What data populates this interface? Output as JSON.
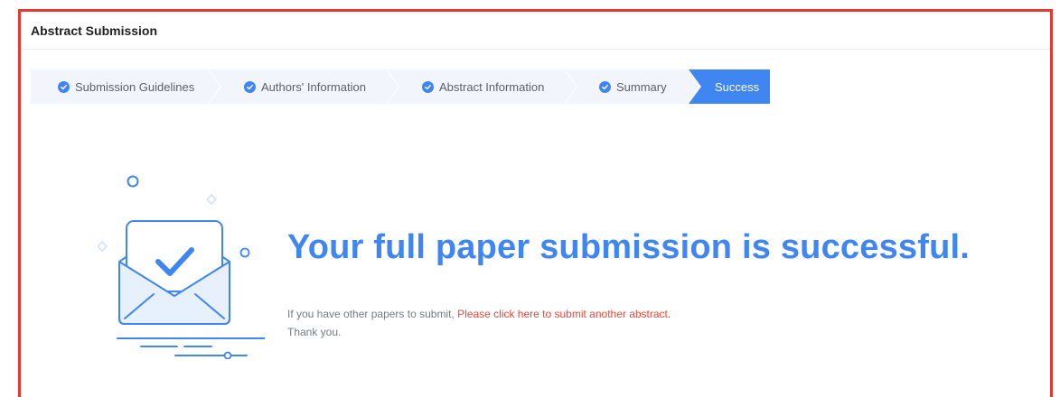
{
  "header": {
    "title": "Abstract Submission"
  },
  "steps": [
    {
      "label": "Submission Guidelines",
      "icon": "check-circle-icon",
      "state": "done"
    },
    {
      "label": "Authors' Information",
      "icon": "check-circle-icon",
      "state": "done"
    },
    {
      "label": "Abstract Information",
      "icon": "check-circle-icon",
      "state": "done"
    },
    {
      "label": "Summary",
      "icon": "check-circle-icon",
      "state": "done"
    },
    {
      "label": "Success",
      "state": "active"
    }
  ],
  "result": {
    "title": "Your full paper submission is successful.",
    "message_prefix": "If you have other papers to submit, ",
    "link_text": "Please click here to submit another abstract.",
    "thanks": "Thank you."
  },
  "colors": {
    "accent": "#3f86f2",
    "frame_border": "#e53a2f",
    "link": "#e8483b",
    "step_bg": "#f2f6fc"
  }
}
